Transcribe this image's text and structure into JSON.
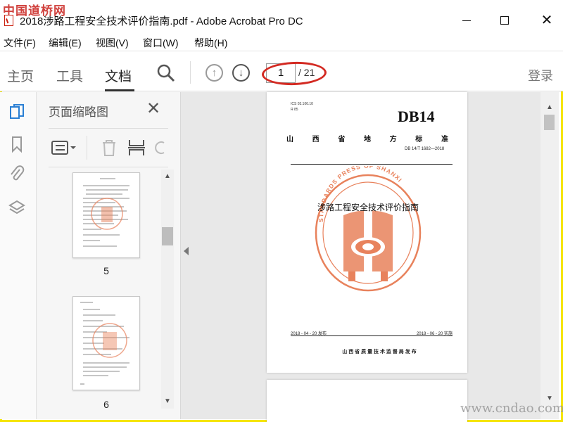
{
  "watermark": {
    "top_left": "中国道桥网",
    "bottom_right": "www.cndao.com"
  },
  "window": {
    "title": "2018涉路工程安全技术评价指南.pdf - Adobe Acrobat Pro DC"
  },
  "menu": [
    "文件(F)",
    "编辑(E)",
    "视图(V)",
    "窗口(W)",
    "帮助(H)"
  ],
  "toolbar": {
    "tabs": [
      "主页",
      "工具",
      "文档"
    ],
    "active_tab": "文档",
    "page_current": "1",
    "page_total": "/ 21",
    "login": "登录"
  },
  "thumbnails": {
    "title": "页面缩略图",
    "pages": [
      "5",
      "6"
    ]
  },
  "document": {
    "ics": "ICS 03.100.10",
    "cat": "R 85",
    "code": "DB14",
    "region_title": [
      "山",
      "西",
      "省",
      "地",
      "方",
      "标",
      "准"
    ],
    "std_number": "DB 14/T 1682—2018",
    "title": "涉路工程安全技术评价指南",
    "seal_text": "STANDARDS PRESS OF SHANXI",
    "publish_date": "2018 - 04 - 20 发布",
    "effective_date": "2018 - 06 - 20 实施",
    "issuer": "山 西 省 质 量 技 术 监 督 局     发 布"
  },
  "colors": {
    "highlight_oval": "#d32a22",
    "seal": "#e8825c",
    "frame": "#f5e400"
  }
}
